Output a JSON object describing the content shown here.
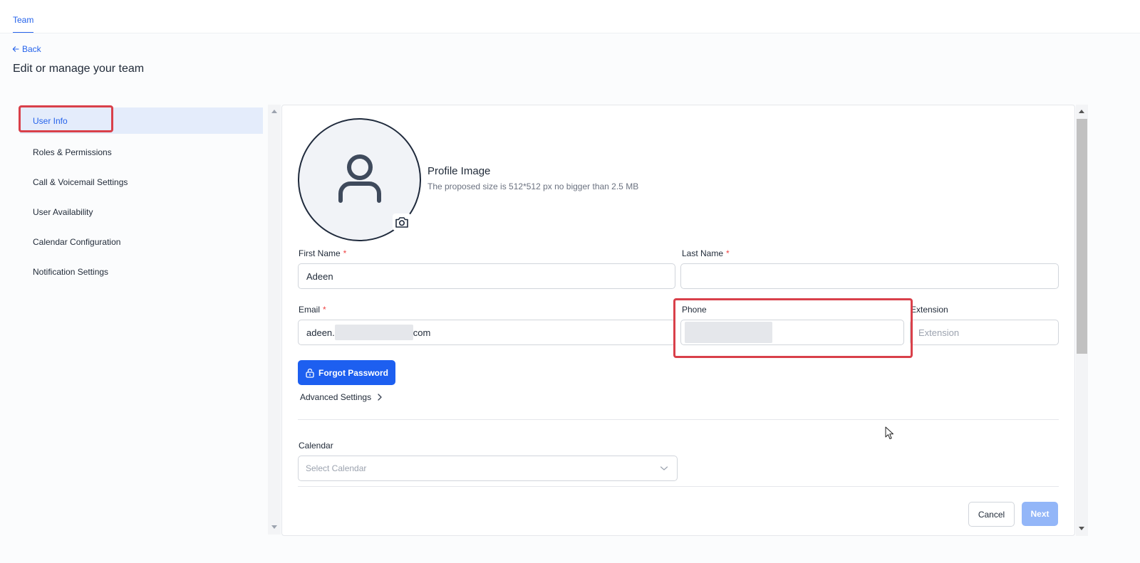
{
  "tabs": [
    {
      "label": "Team"
    }
  ],
  "nav": {
    "back_label": "Back",
    "page_title": "Edit or manage your team"
  },
  "sidebar": {
    "items": [
      {
        "label": "User Info",
        "active": true
      },
      {
        "label": "Roles & Permissions"
      },
      {
        "label": "Call & Voicemail Settings"
      },
      {
        "label": "User Availability"
      },
      {
        "label": "Calendar Configuration"
      },
      {
        "label": "Notification Settings"
      }
    ]
  },
  "profile": {
    "title": "Profile Image",
    "subtitle": "The proposed size is 512*512 px no bigger than 2.5 MB",
    "avatar_icon": "user-icon",
    "upload_icon": "camera-icon"
  },
  "form": {
    "first_name": {
      "label": "First Name",
      "required": "*",
      "value": "Adeen"
    },
    "last_name": {
      "label": "Last Name",
      "required": "*",
      "value": ""
    },
    "email": {
      "label": "Email",
      "required": "*",
      "value_prefix": "adeen.",
      "value_suffix": "com"
    },
    "phone": {
      "label": "Phone",
      "value": ""
    },
    "extension": {
      "label": "Extension",
      "placeholder": "Extension"
    },
    "forgot_password": {
      "label": "Forgot Password",
      "icon": "unlock-icon"
    },
    "advanced_settings": {
      "label": "Advanced Settings",
      "icon": "chevron-right-icon"
    },
    "calendar": {
      "label": "Calendar",
      "placeholder": "Select Calendar",
      "icon": "chevron-down-icon"
    }
  },
  "actions": {
    "cancel_label": "Cancel",
    "next_label": "Next"
  },
  "colors": {
    "accent": "#1d5ff0",
    "highlight": "#d9404a",
    "active_bg": "#e4ecfb",
    "next_disabled": "#93b6f8"
  }
}
